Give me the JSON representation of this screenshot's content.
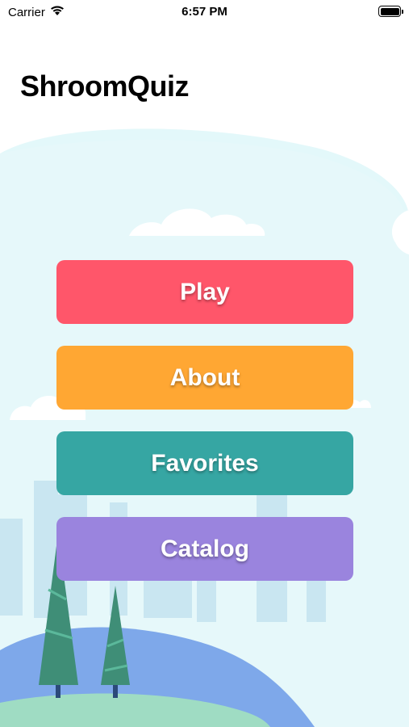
{
  "status_bar": {
    "carrier": "Carrier",
    "time": "6:57 PM",
    "wifi_icon": "wifi-icon",
    "battery_icon": "battery-icon"
  },
  "app": {
    "title": "ShroomQuiz"
  },
  "menu": {
    "buttons": [
      {
        "label": "Play",
        "color": "#FF566A"
      },
      {
        "label": "About",
        "color": "#FFA733"
      },
      {
        "label": "Favorites",
        "color": "#36A6A3"
      },
      {
        "label": "Catalog",
        "color": "#9A84DE"
      }
    ]
  },
  "theme": {
    "sky": "#E3F8FA",
    "cloud": "#FFFFFF",
    "buildings": "#C9E6F1",
    "hill_blue": "#7EA8EA",
    "hill_green": "#9FDCC3",
    "tree": "#3F8E77",
    "tree_trunk": "#2B4A7A"
  }
}
